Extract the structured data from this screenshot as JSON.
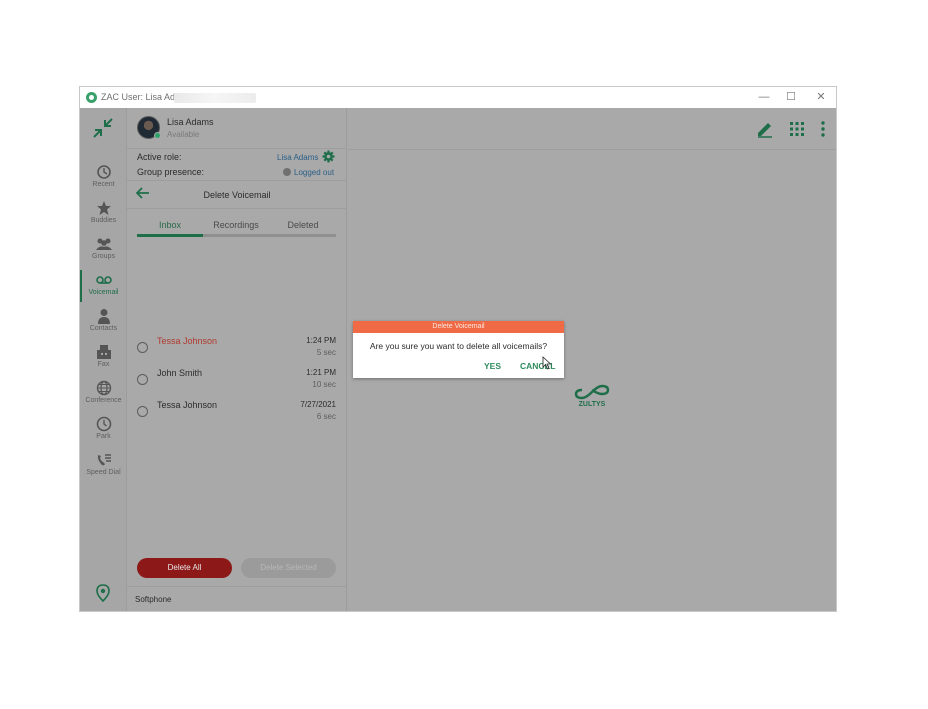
{
  "window": {
    "title": "ZAC User: Lisa Adams",
    "controls": {
      "minimize": "—",
      "maximize": "☐",
      "close": "✕"
    }
  },
  "sidebar": {
    "items": [
      {
        "label": "Recent",
        "icon": "history-icon"
      },
      {
        "label": "Buddies",
        "icon": "star-icon"
      },
      {
        "label": "Groups",
        "icon": "groups-icon"
      },
      {
        "label": "Voicemail",
        "icon": "voicemail-icon",
        "active": true
      },
      {
        "label": "Contacts",
        "icon": "contact-icon"
      },
      {
        "label": "Fax",
        "icon": "fax-icon"
      },
      {
        "label": "Conference",
        "icon": "globe-icon"
      },
      {
        "label": "Park",
        "icon": "clock-icon"
      },
      {
        "label": "Speed Dial",
        "icon": "speed-dial-icon"
      }
    ]
  },
  "user": {
    "name": "Lisa Adams",
    "status": "Available"
  },
  "role": {
    "label": "Active role:",
    "value": "Lisa Adams"
  },
  "group_presence": {
    "label": "Group presence:",
    "value": "Logged out"
  },
  "panel": {
    "title": "Delete Voicemail",
    "tabs": [
      {
        "label": "Inbox",
        "active": true
      },
      {
        "label": "Recordings",
        "active": false
      },
      {
        "label": "Deleted",
        "active": false
      }
    ],
    "voicemails": [
      {
        "name": "Tessa Johnson",
        "time": "1:24 PM",
        "duration": "5 sec",
        "unread": true
      },
      {
        "name": "John Smith",
        "time": "1:21 PM",
        "duration": "10 sec",
        "unread": false
      },
      {
        "name": "Tessa Johnson",
        "time": "7/27/2021",
        "duration": "6 sec",
        "unread": false
      }
    ],
    "delete_all_label": "Delete All",
    "delete_selected_label": "Delete Selected",
    "footer": "Softphone"
  },
  "dialog": {
    "title": "Delete Voicemail",
    "message": "Are you sure you want to delete all voicemails?",
    "yes_label": "YES",
    "cancel_label": "CANCEL"
  },
  "brand": {
    "logo_text": "ZULTYS",
    "accent": "#1e6e4a"
  },
  "colors": {
    "dialog_header": "#f06a45",
    "delete_all": "#8c1818",
    "unread_name": "#b03a2e"
  }
}
